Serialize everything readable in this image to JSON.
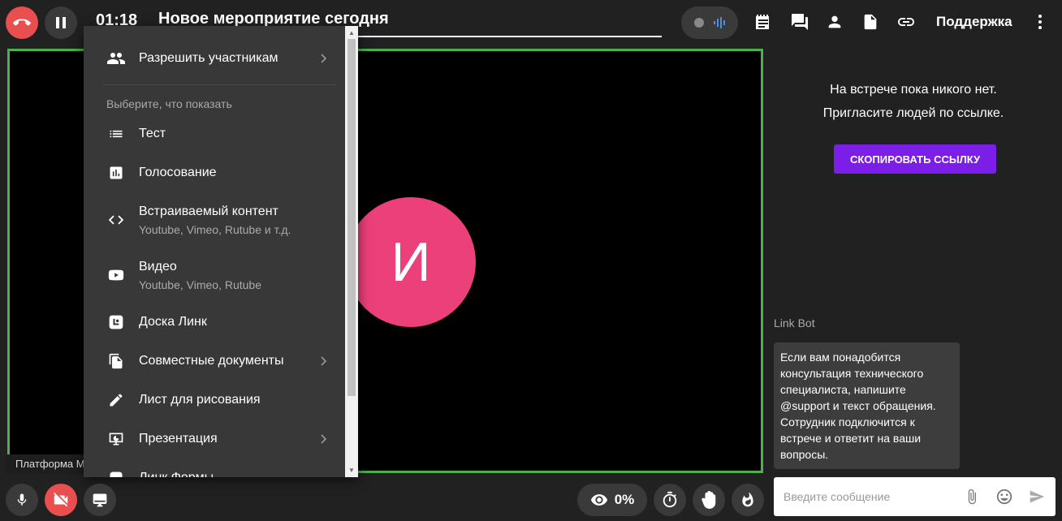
{
  "topbar": {
    "timer": "01:18",
    "title": "Новое мероприятие сегодня",
    "support_label": "Поддержка"
  },
  "menu": {
    "allow_participants": "Разрешить участникам",
    "section_head": "Выберите, что показать",
    "items": [
      {
        "label": "Тест",
        "sub": ""
      },
      {
        "label": "Голосование",
        "sub": ""
      },
      {
        "label": "Встраиваемый контент",
        "sub": "Youtube, Vimeo, Rutube и т.д."
      },
      {
        "label": "Видео",
        "sub": "Youtube, Vimeo, Rutube"
      },
      {
        "label": "Доска Линк",
        "sub": ""
      },
      {
        "label": "Совместные документы",
        "sub": ""
      },
      {
        "label": "Лист для рисования",
        "sub": ""
      },
      {
        "label": "Презентация",
        "sub": ""
      },
      {
        "label": "Линк Формы",
        "sub": ""
      }
    ]
  },
  "stage": {
    "avatar_letter": "И",
    "name_tag": "Платформа М"
  },
  "side": {
    "empty_line1": "На встрече пока никого нет.",
    "empty_line2": "Пригласите людей по ссылке.",
    "copy_button": "СКОПИРОВАТЬ ССЫЛКУ",
    "bot_name": "Link Bot",
    "bot_message": "Если вам понадобится консультация технического специалиста, напишите @support и текст обращения. Сотрудник подключится к встрече и ответит на ваши вопросы."
  },
  "bottombar": {
    "views_percent": "0%",
    "chat_placeholder": "Введите сообщение"
  },
  "colors": {
    "hangup": "#e94f4f",
    "stage_border": "#4caf50",
    "avatar": "#ec407a",
    "copy_button": "#7b1fe8"
  }
}
